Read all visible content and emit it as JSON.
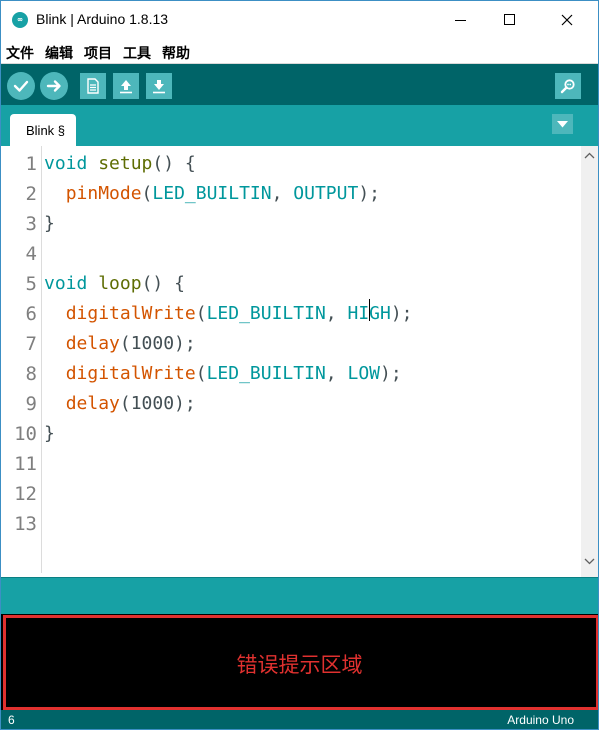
{
  "window": {
    "title": "Blink | Arduino 1.8.13",
    "icon_glyph": "∞"
  },
  "menu": [
    "文件",
    "编辑",
    "项目",
    "工具",
    "帮助"
  ],
  "toolbar": {
    "buttons": [
      "verify-icon",
      "upload-icon",
      "new-icon",
      "open-icon",
      "save-icon",
      "serial-monitor-icon"
    ]
  },
  "tabs": [
    {
      "label": "Blink §",
      "active": true
    }
  ],
  "editor": {
    "line_numbers": [
      "1",
      "2",
      "3",
      "4",
      "5",
      "6",
      "7",
      "8",
      "9",
      "10",
      "11",
      "12",
      "13"
    ],
    "lines": [
      [
        {
          "t": "void",
          "c": "kw-type"
        },
        {
          "t": " "
        },
        {
          "t": "setup",
          "c": "kw-fn"
        },
        {
          "t": "() {"
        }
      ],
      [
        {
          "t": "  "
        },
        {
          "t": "pinMode",
          "c": "fn-call"
        },
        {
          "t": "("
        },
        {
          "t": "LED_BUILTIN",
          "c": "const"
        },
        {
          "t": ", "
        },
        {
          "t": "OUTPUT",
          "c": "const"
        },
        {
          "t": ");"
        }
      ],
      [
        {
          "t": "}"
        }
      ],
      [],
      [
        {
          "t": "void",
          "c": "kw-type"
        },
        {
          "t": " "
        },
        {
          "t": "loop",
          "c": "kw-fn"
        },
        {
          "t": "() {"
        }
      ],
      [
        {
          "t": "  "
        },
        {
          "t": "digitalWrite",
          "c": "fn-call"
        },
        {
          "t": "("
        },
        {
          "t": "LED_BUILTIN",
          "c": "const"
        },
        {
          "t": ", "
        },
        {
          "t": "HIGH",
          "c": "const"
        },
        {
          "t": ");"
        }
      ],
      [
        {
          "t": "  "
        },
        {
          "t": "delay",
          "c": "fn-call"
        },
        {
          "t": "(1000);"
        }
      ],
      [
        {
          "t": "  "
        },
        {
          "t": "digitalWrite",
          "c": "fn-call"
        },
        {
          "t": "("
        },
        {
          "t": "LED_BUILTIN",
          "c": "const"
        },
        {
          "t": ", "
        },
        {
          "t": "LOW",
          "c": "const"
        },
        {
          "t": ");"
        }
      ],
      [
        {
          "t": "  "
        },
        {
          "t": "delay",
          "c": "fn-call"
        },
        {
          "t": "(1000);"
        }
      ],
      [
        {
          "t": "}"
        }
      ],
      [],
      [],
      []
    ]
  },
  "console": {
    "annotation": "错误提示区域"
  },
  "status": {
    "line": "6",
    "board": "Arduino Uno"
  },
  "colors": {
    "toolbar": "#006468",
    "tabbar": "#17a1a5",
    "button": "#4db7bb",
    "annotation": "#e0312f"
  }
}
